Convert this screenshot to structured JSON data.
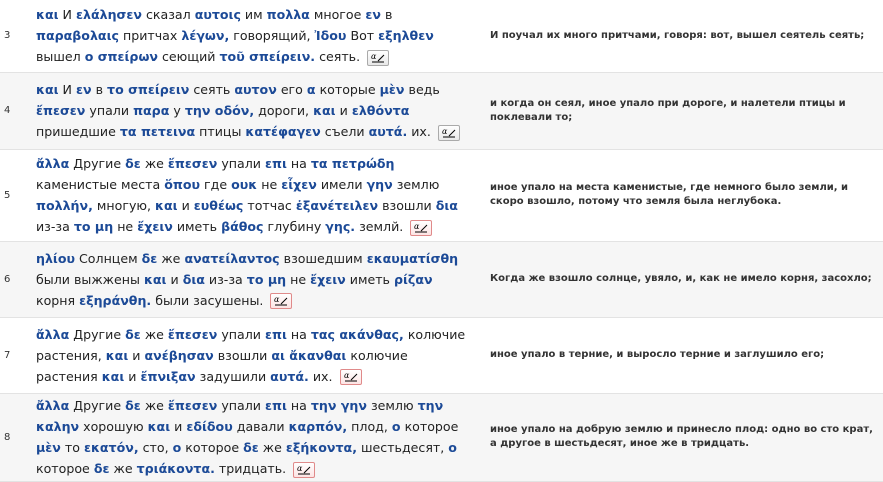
{
  "verses": [
    {
      "number": "3",
      "words": [
        {
          "g": "και",
          "r": "И"
        },
        {
          "g": "ελάλησεν",
          "r": "сказал"
        },
        {
          "g": "αυτοις",
          "r": "им"
        },
        {
          "g": "πολλα",
          "r": "многое"
        },
        {
          "g": "εν",
          "r": "в"
        },
        {
          "g": "παραβολαις",
          "r": "притчах"
        },
        {
          "g": "λέγων,",
          "r": "говорящий,"
        },
        {
          "g": "Ἰδου",
          "r": "Вот"
        },
        {
          "g": "εξηλθεν",
          "r": "вышел"
        },
        {
          "g": "ο σπείρων",
          "r": "сеющий"
        },
        {
          "g": "τοῦ σπείρειν.",
          "r": "сеять."
        }
      ],
      "note_style": "gray",
      "translation": "И поучал их много притчами, говоря: вот, вышел сеятель сеять;"
    },
    {
      "number": "4",
      "words": [
        {
          "g": "και",
          "r": "И"
        },
        {
          "g": "εν",
          "r": "в"
        },
        {
          "g": "το σπείρειν",
          "r": "сеять"
        },
        {
          "g": "αυτον",
          "r": "его"
        },
        {
          "g": "α",
          "r": "которые"
        },
        {
          "g": "μὲν",
          "r": "ведь"
        },
        {
          "g": "ἔπεσεν",
          "r": "упали"
        },
        {
          "g": "παρα",
          "r": "у"
        },
        {
          "g": "την οδόν,",
          "r": "дороги,"
        },
        {
          "g": "και",
          "r": "и"
        },
        {
          "g": "ελθόντα",
          "r": "пришедшие"
        },
        {
          "g": "τα πετεινα",
          "r": "птицы"
        },
        {
          "g": "κατέφαγεν",
          "r": "съели"
        },
        {
          "g": "αυτά.",
          "r": "их."
        }
      ],
      "note_style": "gray",
      "translation": "и когда он сеял, иное упало при дороге, и налетели птицы и поклевали то;"
    },
    {
      "number": "5",
      "words": [
        {
          "g": "ἄλλα",
          "r": "Другие"
        },
        {
          "g": "δε",
          "r": "же"
        },
        {
          "g": "ἔπεσεν",
          "r": "упали"
        },
        {
          "g": "επι",
          "r": "на"
        },
        {
          "g": "τα πετρώδη",
          "r": "каменистые места"
        },
        {
          "g": "ὅπου",
          "r": "где"
        },
        {
          "g": "ουκ",
          "r": "не"
        },
        {
          "g": "εἶχεν",
          "r": "имели"
        },
        {
          "g": "γην",
          "r": "землю"
        },
        {
          "g": "πολλήν,",
          "r": "многую,"
        },
        {
          "g": "και",
          "r": "и"
        },
        {
          "g": "ευθέως",
          "r": "тотчас"
        },
        {
          "g": "ἐξανέτειλεν",
          "r": "взошли"
        },
        {
          "g": "δια",
          "r": "из-за"
        },
        {
          "g": "το μη",
          "r": "не"
        },
        {
          "g": "ἔχειν",
          "r": "иметь"
        },
        {
          "g": "βάθος",
          "r": "глубину"
        },
        {
          "g": "γης.",
          "r": "землй."
        }
      ],
      "note_style": "red",
      "translation": "иное упало на места каменистые, где немного было земли, и скоро взошло, потому что земля была неглубока."
    },
    {
      "number": "6",
      "words": [
        {
          "g": "ηλίου",
          "r": "Солнцем"
        },
        {
          "g": "δε",
          "r": "же"
        },
        {
          "g": "ανατείλαντος",
          "r": "взошедшим"
        },
        {
          "g": "εκαυματίσθη",
          "r": "были выжжены"
        },
        {
          "g": "και",
          "r": "и"
        },
        {
          "g": "δια",
          "r": "из-за"
        },
        {
          "g": "το μη",
          "r": "не"
        },
        {
          "g": "ἔχειν",
          "r": "иметь"
        },
        {
          "g": "ρίζαν",
          "r": "корня"
        },
        {
          "g": "εξηράνθη.",
          "r": "были засушены."
        }
      ],
      "note_style": "red",
      "translation": "Когда же взошло солнце, увяло, и, как не имело корня, засохло;"
    },
    {
      "number": "7",
      "words": [
        {
          "g": "ἄλλα",
          "r": "Другие"
        },
        {
          "g": "δε",
          "r": "же"
        },
        {
          "g": "ἔπεσεν",
          "r": "упали"
        },
        {
          "g": "επι",
          "r": "на"
        },
        {
          "g": "τας ακάνθας,",
          "r": "колючие растения,"
        },
        {
          "g": "και",
          "r": "и"
        },
        {
          "g": "ανέβησαν",
          "r": "взошли"
        },
        {
          "g": "αι ἄκανθαι",
          "r": "колючие растения"
        },
        {
          "g": "και",
          "r": "и"
        },
        {
          "g": "ἔπνιξαν",
          "r": "задушили"
        },
        {
          "g": "αυτά.",
          "r": "их."
        }
      ],
      "note_style": "red",
      "translation": "иное упало в терние, и выросло терние и заглушило его;"
    },
    {
      "number": "8",
      "words": [
        {
          "g": "ἄλλα",
          "r": "Другие"
        },
        {
          "g": "δε",
          "r": "же"
        },
        {
          "g": "ἔπεσεν",
          "r": "упали"
        },
        {
          "g": "επι",
          "r": "на"
        },
        {
          "g": "την γην",
          "r": "землю"
        },
        {
          "g": "την καλην",
          "r": "хорошую"
        },
        {
          "g": "και",
          "r": "и"
        },
        {
          "g": "εδίδου",
          "r": "давали"
        },
        {
          "g": "καρπόν,",
          "r": "плод,"
        },
        {
          "g": "ο",
          "r": "которое"
        },
        {
          "g": "μὲν",
          "r": "то"
        },
        {
          "g": "εκατόν,",
          "r": "сто,"
        },
        {
          "g": "ο",
          "r": "которое"
        },
        {
          "g": "δε",
          "r": "же"
        },
        {
          "g": "εξήκοντα,",
          "r": "шестьдесят,"
        },
        {
          "g": "ο",
          "r": "которое"
        },
        {
          "g": "δε",
          "r": "же"
        },
        {
          "g": "τριάκοντα.",
          "r": "тридцать."
        }
      ],
      "note_style": "red",
      "translation": "иное упало на добрую землю и принесло плод: одно во сто крат, а другое в шестьдесят, иное же в тридцать."
    }
  ],
  "note_icon": "alpha-note-icon",
  "colors": {
    "greek": "#1c4a97",
    "row_shade": "#f6f6f6",
    "note_red_border": "#e08a8a"
  }
}
